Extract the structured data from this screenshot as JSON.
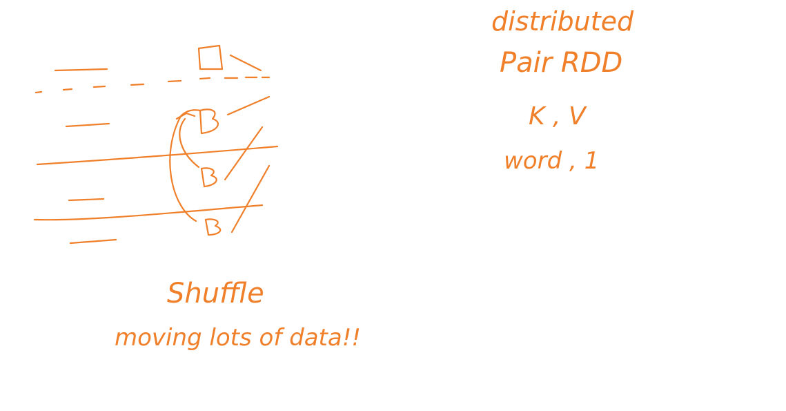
{
  "ink_color": "#f07f2a",
  "labels": {
    "line1": "distributed",
    "line2": "Pair RDD",
    "line3": "K , V",
    "line4": "word , 1",
    "shuffle": "Shuffle",
    "moving": "moving lots of data!!"
  },
  "blocks": {
    "top_marker": "□",
    "block_b1": "B",
    "block_b2": "B",
    "block_b3": "B"
  }
}
